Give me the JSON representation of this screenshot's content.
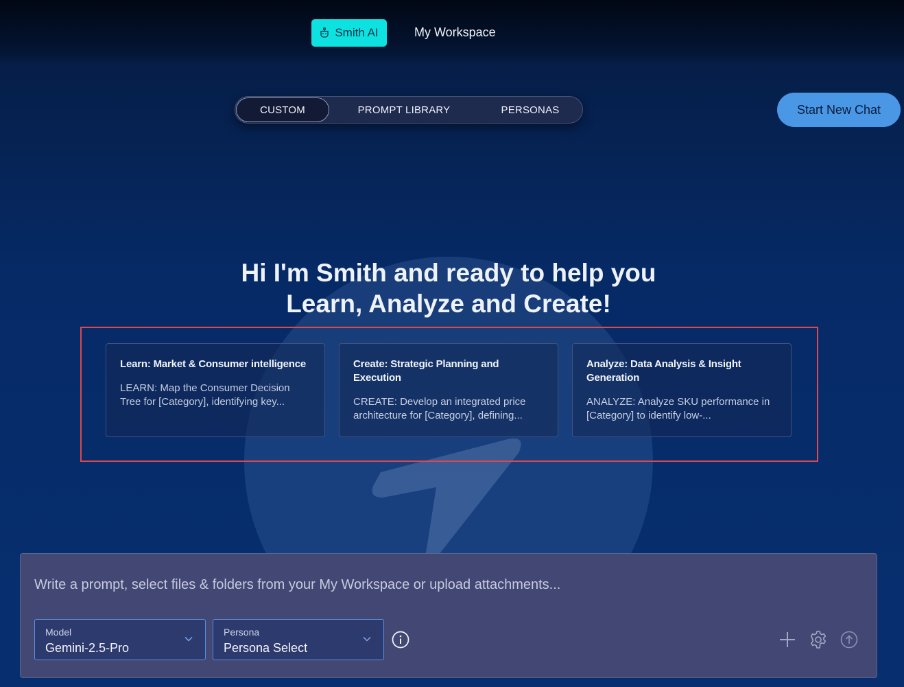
{
  "nav": {
    "brand_label": "Smith AI",
    "workspace_label": "My Workspace"
  },
  "tabs": [
    {
      "label": "CUSTOM"
    },
    {
      "label": "PROMPT LIBRARY"
    },
    {
      "label": "PERSONAS"
    }
  ],
  "new_chat_label": "Start New Chat",
  "headline": {
    "line1": "Hi I'm Smith and ready to help you",
    "line2": "Learn, Analyze and Create!"
  },
  "cards": [
    {
      "title": "Learn: Market & Consumer intelligence",
      "desc": "LEARN: Map the Consumer Decision Tree for [Category], identifying key..."
    },
    {
      "title": "Create: Strategic Planning and Execution",
      "desc": "CREATE: Develop an integrated price architecture for [Category], defining..."
    },
    {
      "title": "Analyze: Data Analysis & Insight Generation",
      "desc": "ANALYZE: Analyze SKU performance in [Category] to identify low-..."
    }
  ],
  "composer": {
    "placeholder": "Write a prompt, select files & folders from your My Workspace or upload attachments...",
    "model": {
      "label": "Model",
      "value": "Gemini-2.5-Pro"
    },
    "persona": {
      "label": "Persona",
      "value": "Persona Select"
    }
  },
  "colors": {
    "accent_cyan": "#0ee2e0",
    "primary_button": "#4a97e6",
    "highlight_border": "#e0474e"
  }
}
